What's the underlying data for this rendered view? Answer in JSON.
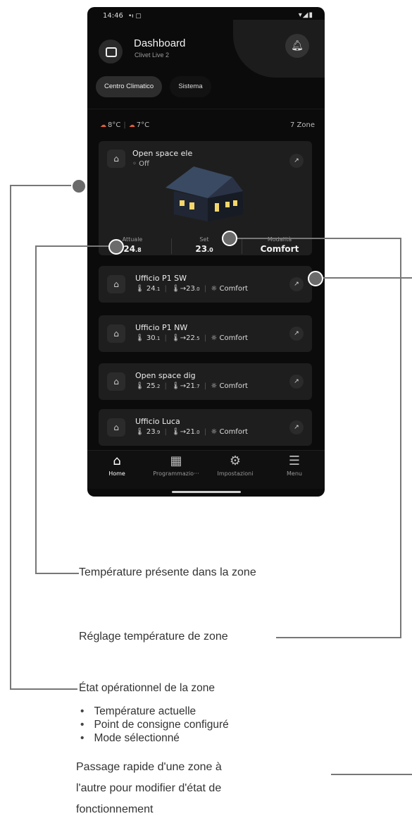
{
  "status_bar": {
    "time": "14:46",
    "notif_icons": "•ᵼ ▢",
    "right_icons": "▾◢▮"
  },
  "header": {
    "title": "Dashboard",
    "subtitle": "Clivet Live 2"
  },
  "tabs": [
    {
      "label": "Centro Climatico",
      "active": true
    },
    {
      "label": "Sistema",
      "active": false
    }
  ],
  "weather": {
    "temp1": "8°C",
    "temp2": "7°C",
    "zones": "7 Zone"
  },
  "featured_zone": {
    "name": "Open space ele",
    "status": "◦ Off",
    "labels": {
      "current": "Attuale",
      "set": "Set",
      "mode": "Modalità"
    },
    "current_main": "24",
    "current_dec": ".8",
    "set_main": "23",
    "set_dec": ".0",
    "mode": "Comfort"
  },
  "zones": [
    {
      "name": "Ufficio P1 SW",
      "current_main": "24",
      "current_dec": ".1",
      "set_main": "23",
      "set_dec": ".0",
      "mode": "Comfort"
    },
    {
      "name": "Ufficio P1 NW",
      "current_main": "30",
      "current_dec": ".1",
      "set_main": "22",
      "set_dec": ".5",
      "mode": "Comfort"
    },
    {
      "name": "Open space dig",
      "current_main": "25",
      "current_dec": ".2",
      "set_main": "21",
      "set_dec": ".7",
      "mode": "Comfort"
    },
    {
      "name": "Ufficio Luca",
      "current_main": "23",
      "current_dec": ".9",
      "set_main": "21",
      "set_dec": ".0",
      "mode": "Comfort"
    }
  ],
  "nav": [
    {
      "label": "Home",
      "icon": "home-icon",
      "active": true
    },
    {
      "label": "Programmazio···",
      "icon": "calendar-icon",
      "active": false
    },
    {
      "label": "Impostazioni",
      "icon": "gear-icon",
      "active": false
    },
    {
      "label": "Menu",
      "icon": "menu-icon",
      "active": false
    }
  ],
  "annotations": {
    "temp_zone": "Température présente dans la zone",
    "setpoint": "Réglage température de zone",
    "state_title": "État opérationnel de la zone",
    "state_items": [
      "Température actuelle",
      "Point de consigne configuré",
      "Mode sélectionné"
    ],
    "quick_line1": "Passage rapide d'une zone à",
    "quick_line2": "l'autre pour modifier d'état de",
    "quick_line3": "fonctionnement"
  }
}
